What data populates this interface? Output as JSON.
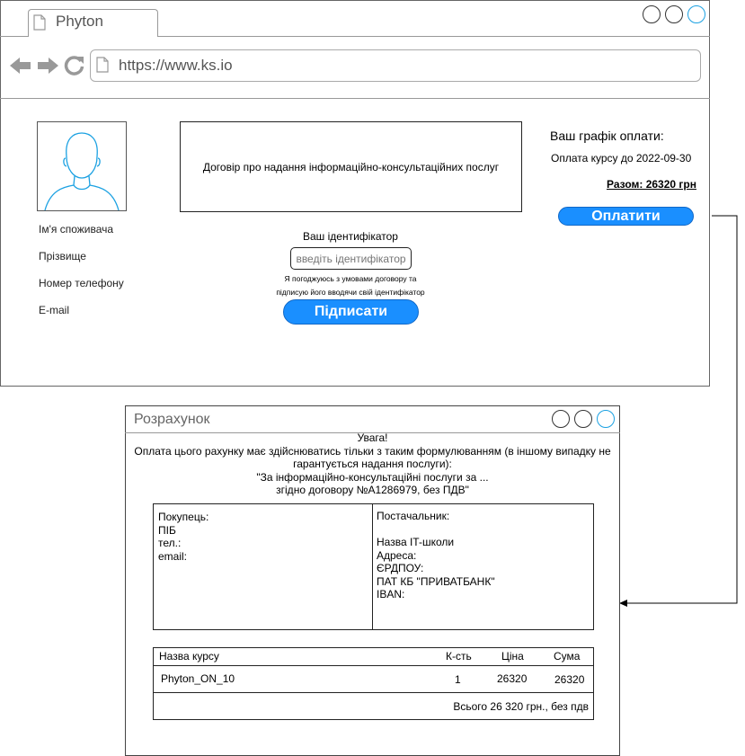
{
  "browser": {
    "tab_title": "Phyton",
    "url": "https://www.ks.io"
  },
  "profile": {
    "name_label": "Ім'я споживача",
    "surname_label": "Прізвище",
    "phone_label": "Номер телефону",
    "email_label": "E-mail"
  },
  "contract": {
    "title": "Договір про надання інформаційно-консультаційних послуг"
  },
  "identifier": {
    "label": "Ваш ідентифікатор",
    "placeholder": "введіть ідентифікатор",
    "agree_line1": "Я погоджуюсь з умовами договору та",
    "agree_line2": "підписую його вводячи свій ідентифікатор",
    "sign_button": "Підписати"
  },
  "schedule": {
    "title": "Ваш графік оплати:",
    "due": "Оплата курсу до 2022-09-30",
    "total": "Разом: 26320 грн",
    "pay_button": "Оплатити"
  },
  "invoice": {
    "title": "Розрахунок",
    "warning_lines": [
      "Увага!",
      "Оплата цього рахунку має здійснюватись тільки з таким формулюванням (в іншому випадку не",
      "гарантується надання послуги):",
      "\"За інформаційно-консультаційні послуги за ...",
      "згідно договору №А1286979, без ПДВ\""
    ],
    "buyer_lines": [
      "Покупець:",
      "ПІБ",
      "тел.:",
      "email:"
    ],
    "supplier_lines": [
      "Постачальник:",
      "",
      "Назва IT-школи",
      "Адреса:",
      "ЄРДПОУ:",
      "ПАТ КБ \"ПРИВАТБАНК\"",
      "IBAN:"
    ],
    "table": {
      "headers": {
        "course": "Назва курсу",
        "qty": "К-сть",
        "price": "Ціна",
        "sum": "Сума"
      },
      "row": {
        "course": "Phyton_ON_10",
        "qty": "1",
        "price": "26320",
        "sum": "26320"
      },
      "total": "Всього 26 320 грн., без пдв"
    }
  },
  "colors": {
    "accent": "#1a8fff",
    "window_btn_highlight": "#1ba1e2"
  }
}
